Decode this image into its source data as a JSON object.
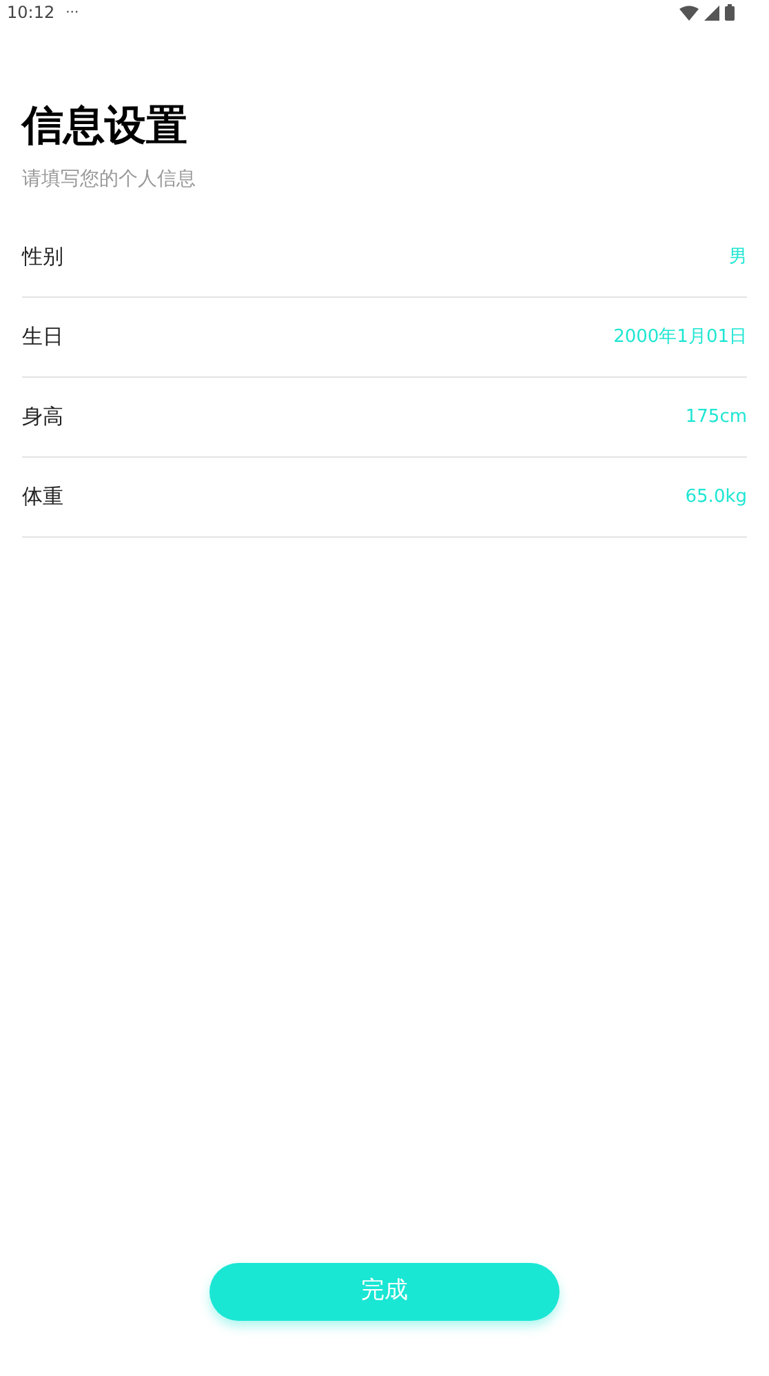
{
  "status_bar": {
    "time": "10:12",
    "more": "···"
  },
  "title": "信息设置",
  "subtitle": "请填写您的个人信息",
  "fields": [
    {
      "label": "性别",
      "value": "男"
    },
    {
      "label": "生日",
      "value": "2000年1月01日"
    },
    {
      "label": "身高",
      "value": "175cm"
    },
    {
      "label": "体重",
      "value": "65.0kg"
    }
  ],
  "submit_button": "完成"
}
